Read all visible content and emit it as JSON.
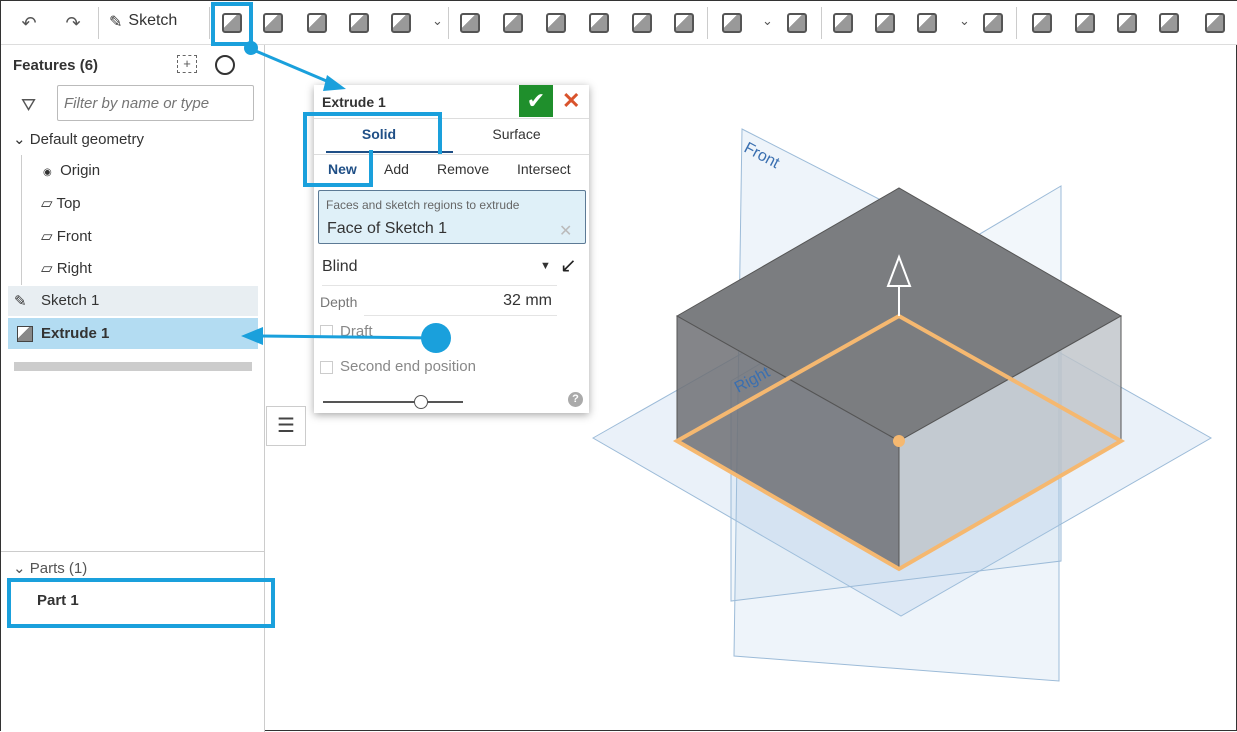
{
  "toolbar": {
    "sketch_label": "Sketch",
    "icons": [
      "undo-icon",
      "redo-icon",
      "extrude-icon",
      "revolve-icon",
      "sweep-icon",
      "loft-icon",
      "thicken-icon",
      "fillet-icon",
      "chamfer-icon",
      "draft-icon",
      "rib-icon",
      "shell-icon",
      "hole-icon",
      "pattern-icon",
      "mirror-icon",
      "boolean-icon",
      "split-icon",
      "transform-icon",
      "delete-part-icon",
      "modify-fillet-icon",
      "delete-face-icon",
      "move-face-icon",
      "replace-face-icon",
      "offset-surface-icon"
    ]
  },
  "sidebar": {
    "features_title": "Features (6)",
    "filter_placeholder": "Filter by name or type",
    "default_geometry": "Default geometry",
    "items": [
      {
        "label": "Origin"
      },
      {
        "label": "Top"
      },
      {
        "label": "Front"
      },
      {
        "label": "Right"
      },
      {
        "label": "Sketch 1"
      },
      {
        "label": "Extrude 1"
      }
    ],
    "parts_title": "Parts (1)",
    "part": "Part 1"
  },
  "dialog": {
    "title": "Extrude 1",
    "tabs": [
      "Solid",
      "Surface"
    ],
    "ops": [
      "New",
      "Add",
      "Remove",
      "Intersect"
    ],
    "selection_label": "Faces and sketch regions to extrude",
    "selection_value": "Face of Sketch 1",
    "end_type": "Blind",
    "depth_label": "Depth",
    "depth_value": "32 mm",
    "draft_label": "Draft",
    "second_end_label": "Second end position",
    "slider_value": 0.7
  },
  "viewport": {
    "plane_labels": [
      "Front",
      "Right"
    ]
  },
  "colors": {
    "highlight": "#1aa0dc",
    "accept": "#1f8f2c",
    "cancel": "#d9532c",
    "selected_row": "#b3dcf2",
    "sketch_edge": "#f5b870"
  }
}
